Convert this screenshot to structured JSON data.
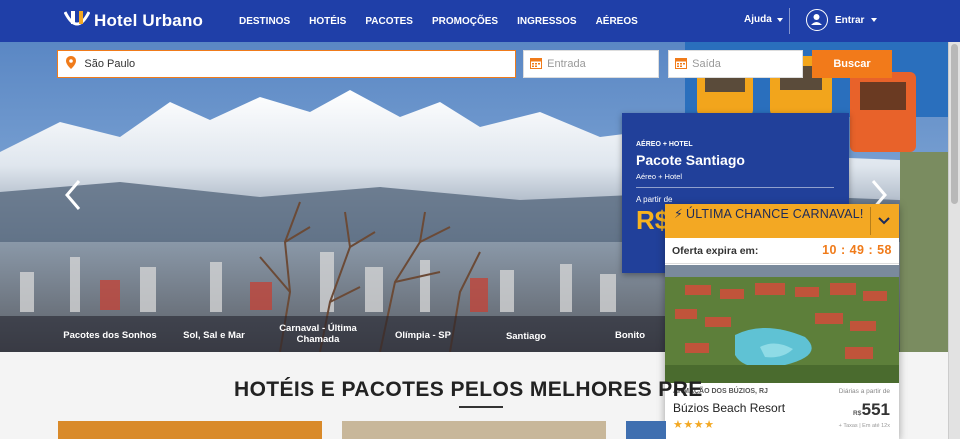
{
  "header": {
    "brand": "Hotel Urbano",
    "nav": [
      "DESTINOS",
      "HOTÉIS",
      "PACOTES",
      "PROMOÇÕES",
      "INGRESSOS",
      "AÉREOS"
    ],
    "help_label": "Ajuda",
    "login_label": "Entrar"
  },
  "search": {
    "destination_value": "São Paulo",
    "checkin_placeholder": "Entrada",
    "checkout_placeholder": "Saída",
    "button_label": "Buscar"
  },
  "hero": {
    "categories": [
      "Pacotes dos Sonhos",
      "Sol, Sal e Mar",
      "Carnaval - Última Chamada",
      "Olímpia - SP",
      "Santiago",
      "Bonito"
    ]
  },
  "promo": {
    "kicker": "AÉREO + HOTEL",
    "title": "Pacote Santiago",
    "subtitle": "Aéreo + Hotel",
    "from_label": "A partir de",
    "price_prefix": "R$"
  },
  "deal": {
    "headline": "ÚLTIMA CHANCE CARNAVAL!",
    "expire_label": "Oferta expira em:",
    "timer": "10 : 49 : 58",
    "location": "ARMAÇÃO DOS BÚZIOS, RJ",
    "name": "Búzios Beach Resort",
    "stars": "★★★★",
    "daily_label": "Diárias a partir de",
    "currency": "R$",
    "price": "551",
    "tax_note": "+ Taxas | Em até 12x"
  },
  "section": {
    "title": "HOTÉIS E PACOTES PELOS MELHORES PRE"
  },
  "colors": {
    "header": "#1f3fa8",
    "accent": "#f27a1a",
    "promo": "#21409a",
    "deal_head": "#f3a823"
  }
}
